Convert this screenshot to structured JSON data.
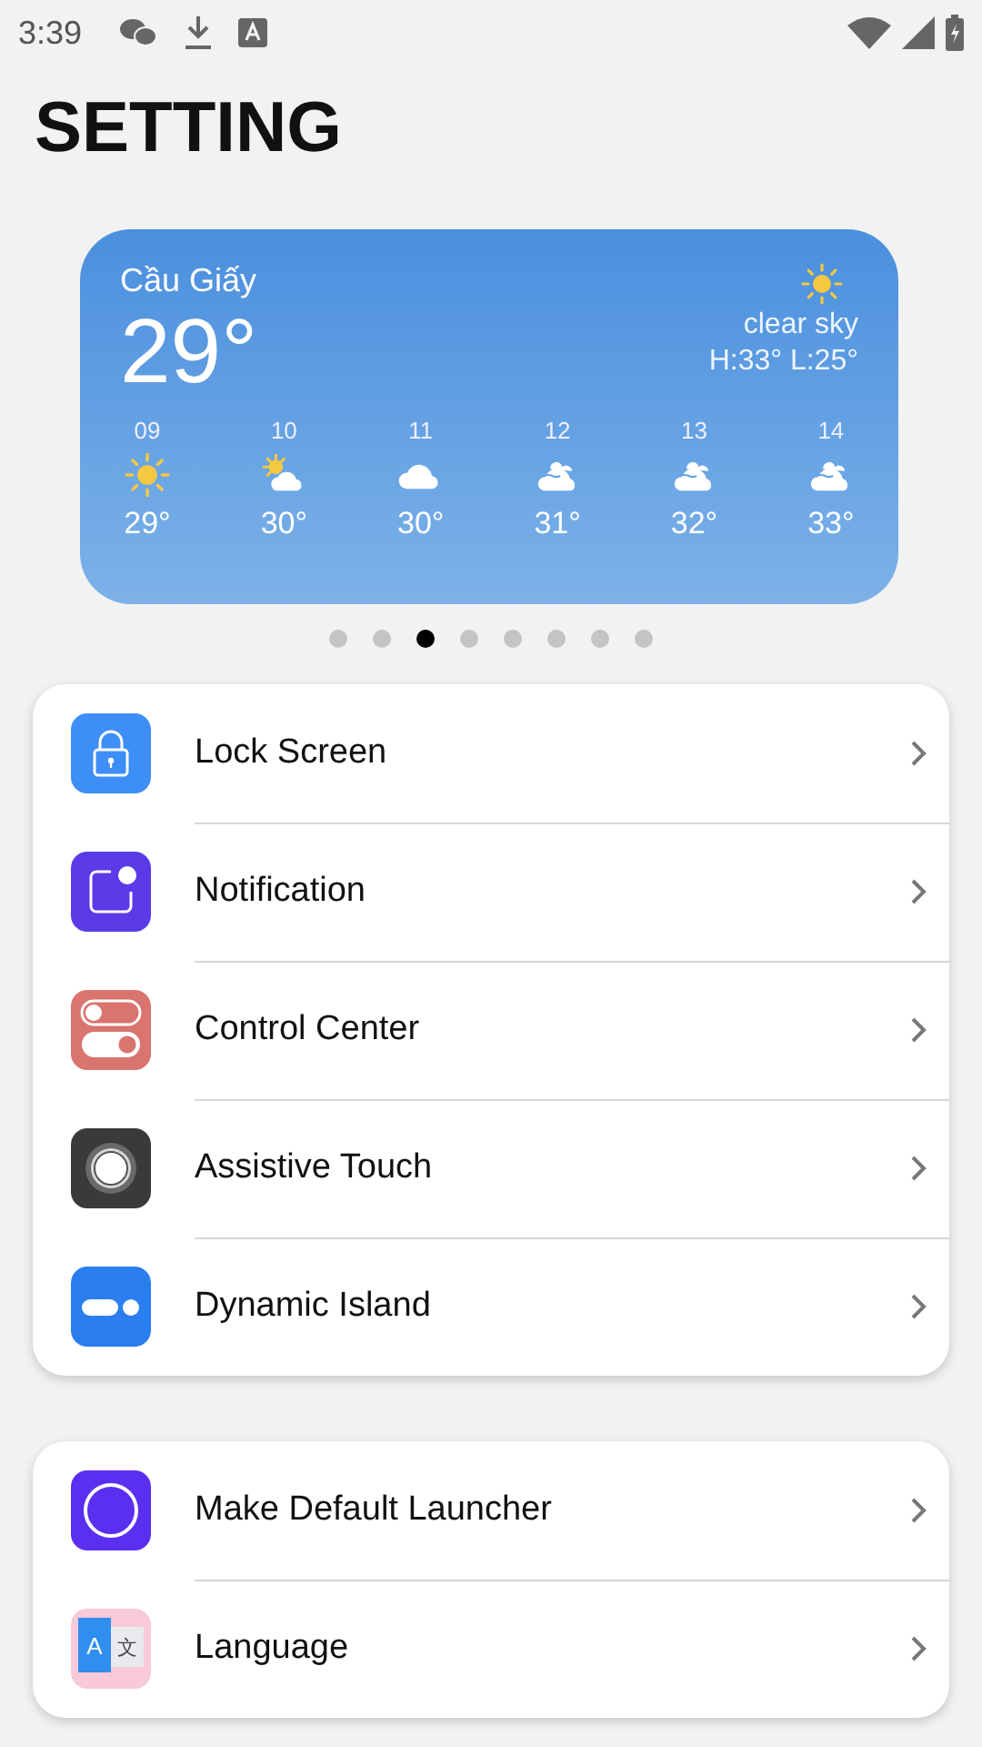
{
  "status_bar": {
    "time": "3:39"
  },
  "title": "SETTING",
  "weather": {
    "location": "Cầu Giấy",
    "temperature": "29°",
    "condition": "clear sky",
    "high_low": "H:33° L:25°",
    "kind": "sun",
    "hours": [
      {
        "hour": "09",
        "kind": "sun",
        "temp": "29°"
      },
      {
        "hour": "10",
        "kind": "sun_cloud",
        "temp": "30°"
      },
      {
        "hour": "11",
        "kind": "cloud",
        "temp": "30°"
      },
      {
        "hour": "12",
        "kind": "clouds",
        "temp": "31°"
      },
      {
        "hour": "13",
        "kind": "clouds",
        "temp": "32°"
      },
      {
        "hour": "14",
        "kind": "clouds",
        "temp": "33°"
      }
    ]
  },
  "pager": [
    {
      "selected": false
    },
    {
      "selected": false
    },
    {
      "selected": true
    },
    {
      "selected": false
    },
    {
      "selected": false
    },
    {
      "selected": false
    },
    {
      "selected": false
    },
    {
      "selected": false
    }
  ],
  "groups": [
    {
      "items": [
        {
          "kind": "lock",
          "label": "Lock Screen"
        },
        {
          "kind": "notification",
          "label": "Notification"
        },
        {
          "kind": "toggles",
          "label": "Control Center"
        },
        {
          "kind": "touch",
          "label": "Assistive Touch"
        },
        {
          "kind": "island",
          "label": "Dynamic Island"
        }
      ]
    },
    {
      "items": [
        {
          "kind": "launcher",
          "label": "Make Default Launcher"
        },
        {
          "kind": "language",
          "label": "Language",
          "glyphs": [
            "A",
            "文"
          ]
        }
      ]
    }
  ]
}
